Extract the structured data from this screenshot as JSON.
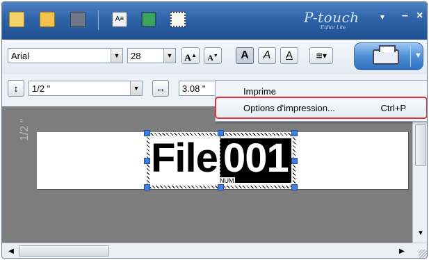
{
  "app": {
    "logo": "P-touch",
    "logo_sub": "Editor Lite",
    "minimize": "–",
    "close": "×",
    "menu_arrow": "▼"
  },
  "toolbar": {
    "icons": [
      "new-label-icon",
      "open-folder-icon",
      "save-disk-icon",
      "text-icon",
      "image-icon",
      "frame-icon"
    ]
  },
  "format": {
    "font": "Arial",
    "size": "28",
    "grow_font": "A",
    "shrink_font": "A",
    "bold": "A",
    "italic": "A",
    "underline": "A",
    "align_icon": "align-left-icon"
  },
  "length_bar": {
    "tape_width": "1/2 \"",
    "length": "3.08 \""
  },
  "context_menu": {
    "items": [
      {
        "label": "Imprime",
        "shortcut": ""
      },
      {
        "label": "Options d'impression...",
        "shortcut": "Ctrl+P"
      }
    ]
  },
  "label": {
    "ruler": "1/2 \"",
    "text_plain": "File ",
    "text_selected": "001",
    "num_tag": "NUM"
  },
  "colors": {
    "titlebar": "#2f63a8",
    "highlight_ring": "#e0303a",
    "canvas": "#7d7d7d",
    "handle": "#3f7fe0"
  }
}
